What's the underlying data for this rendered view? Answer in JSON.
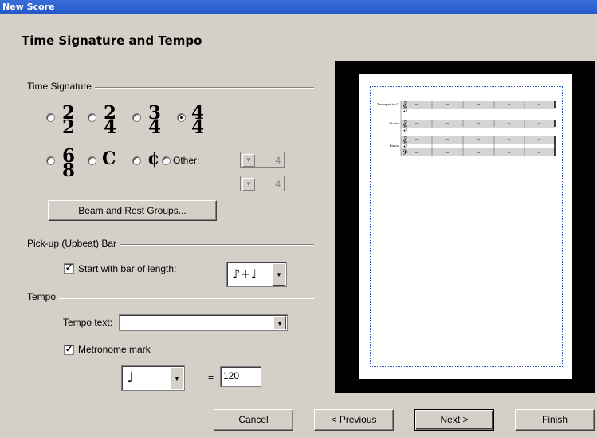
{
  "window": {
    "title": "New Score"
  },
  "page": {
    "heading": "Time Signature and Tempo"
  },
  "time_signature": {
    "label": "Time Signature",
    "options": [
      {
        "top": "2",
        "bottom": "2",
        "selected": false
      },
      {
        "top": "2",
        "bottom": "4",
        "selected": false
      },
      {
        "top": "3",
        "bottom": "4",
        "selected": false
      },
      {
        "top": "4",
        "bottom": "4",
        "selected": true
      },
      {
        "top": "6",
        "bottom": "8",
        "selected": false
      }
    ],
    "common_time": "C",
    "cut_time": "¢",
    "other_label": "Other:",
    "other_top": "4",
    "other_bottom": "4",
    "beam_button": "Beam and Rest Groups..."
  },
  "pickup": {
    "label": "Pick-up (Upbeat) Bar",
    "checkbox_label": "Start with bar of length:",
    "checked": true,
    "value": "♪+♩"
  },
  "tempo": {
    "label": "Tempo",
    "tempo_text_label": "Tempo text:",
    "tempo_text_value": "",
    "metronome_label": "Metronome mark",
    "metronome_checked": true,
    "note_value": "♩",
    "equals": "=",
    "bpm": "120"
  },
  "preview": {
    "instruments": [
      "Trumpet in C",
      "Violin",
      "Piano"
    ]
  },
  "footer": {
    "cancel": "Cancel",
    "previous": "< Previous",
    "next": "Next >",
    "finish": "Finish"
  }
}
